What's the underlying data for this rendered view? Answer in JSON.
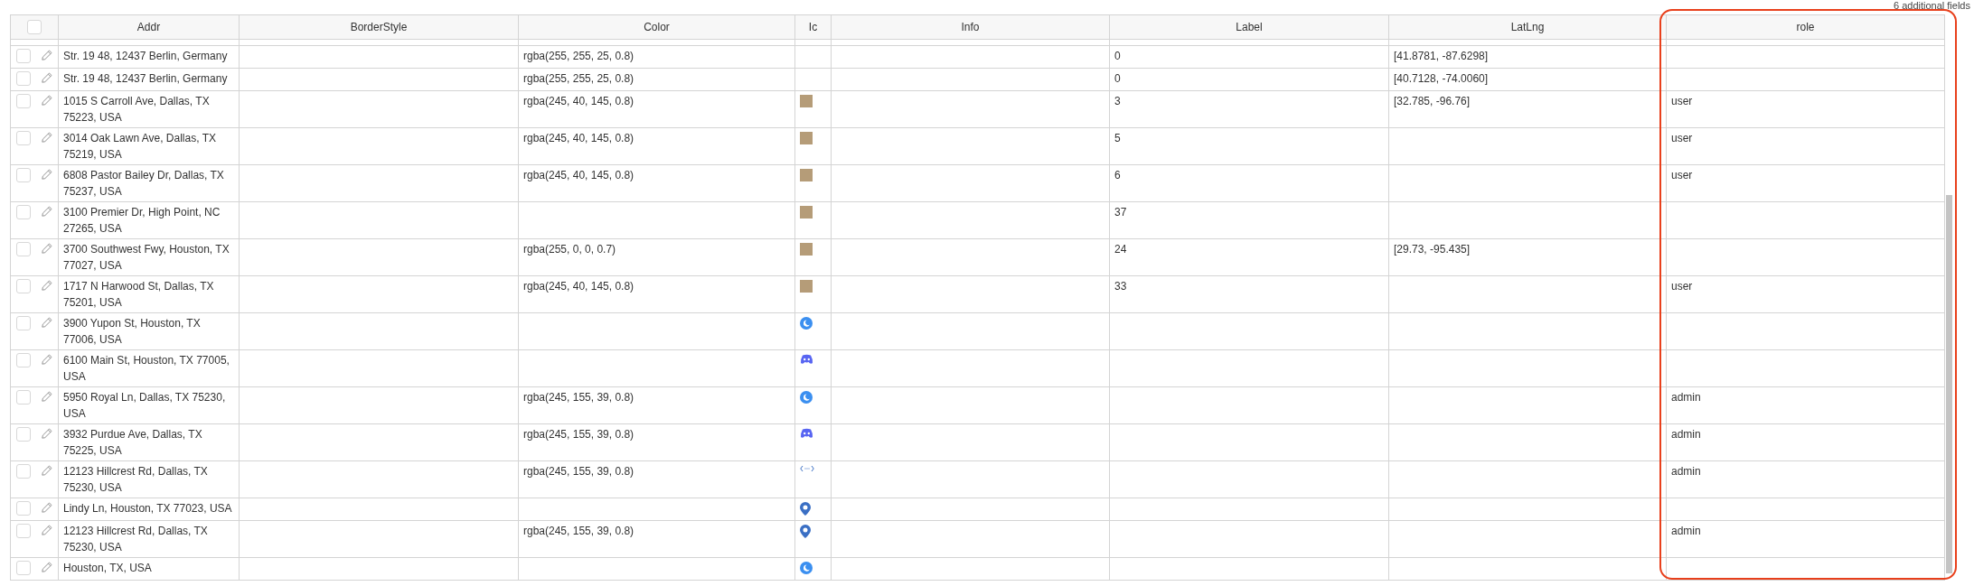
{
  "note": "6 additional fields",
  "table": {
    "select_all": {
      "checked": false
    },
    "columns": [
      {
        "label": "Addr",
        "highlighted": false
      },
      {
        "label": "BorderStyle",
        "highlighted": false
      },
      {
        "label": "Color",
        "highlighted": false
      },
      {
        "label": "Ic",
        "highlighted": false
      },
      {
        "label": "Info",
        "highlighted": false
      },
      {
        "label": "Label",
        "highlighted": false
      },
      {
        "label": "LatLng",
        "highlighted": false
      },
      {
        "label": "role",
        "highlighted": true
      }
    ],
    "rows": [
      {
        "selected": false,
        "addr": "Str. 19 48, 12437 Berlin, Germany",
        "color_text": "rgba(255, 255, 25, 0.8)",
        "label": "0",
        "latlng": "[41.8781, -87.6298]"
      },
      {
        "selected": false,
        "addr": "Str. 19 48, 12437 Berlin, Germany",
        "color_text": "rgba(255, 255, 25, 0.8)",
        "label": "0",
        "latlng": "[40.7128, -74.0060]"
      },
      {
        "selected": false,
        "addr": "1015 S Carroll Ave, Dallas, TX 75223, USA",
        "color_text": "rgba(245, 40, 145, 0.8)",
        "ic": {
          "kind": "photo"
        },
        "label": "3",
        "latlng": "[32.785, -96.76]",
        "role": "user"
      },
      {
        "selected": false,
        "addr": "3014 Oak Lawn Ave, Dallas, TX 75219, USA",
        "color_text": "rgba(245, 40, 145, 0.8)",
        "ic": {
          "kind": "photo"
        },
        "label": "5",
        "role": "user"
      },
      {
        "selected": false,
        "addr": "6808 Pastor Bailey Dr, Dallas, TX 75237, USA",
        "color_text": "rgba(245, 40, 145, 0.8)",
        "ic": {
          "kind": "photo"
        },
        "label": "6",
        "role": "user"
      },
      {
        "selected": false,
        "addr": "3100 Premier Dr, High Point, NC 27265, USA",
        "ic": {
          "kind": "photo"
        },
        "label": "37"
      },
      {
        "selected": false,
        "addr": "3700 Southwest Fwy, Houston, TX 77027, USA",
        "color_text": "rgba(255, 0, 0, 0.7)",
        "ic": {
          "kind": "photo"
        },
        "label": "24",
        "latlng": "[29.73, -95.435]"
      },
      {
        "selected": false,
        "addr": "1717 N Harwood St, Dallas, TX 75201, USA",
        "color_text": "rgba(245, 40, 145, 0.8)",
        "ic": {
          "kind": "photo"
        },
        "label": "33",
        "role": "user"
      },
      {
        "selected": false,
        "addr": "3900 Yupon St, Houston, TX 77006, USA",
        "ic": {
          "kind": "moon"
        }
      },
      {
        "selected": false,
        "addr": "6100 Main St, Houston, TX 77005, USA",
        "ic": {
          "kind": "gamepad"
        }
      },
      {
        "selected": false,
        "addr": "5950 Royal Ln, Dallas, TX 75230, USA",
        "color_text": "rgba(245, 155, 39, 0.8)",
        "ic": {
          "kind": "moon"
        },
        "role": "admin"
      },
      {
        "selected": false,
        "addr": "3932 Purdue Ave, Dallas, TX 75225, USA",
        "color_text": "rgba(245, 155, 39, 0.8)",
        "ic": {
          "kind": "gamepad"
        },
        "role": "admin"
      },
      {
        "selected": false,
        "addr": "12123 Hillcrest Rd, Dallas, TX 75230, USA",
        "color_text": "rgba(245, 155, 39, 0.8)",
        "ic": {
          "kind": "code"
        },
        "role": "admin"
      },
      {
        "selected": false,
        "addr": "Lindy Ln, Houston, TX 77023, USA",
        "ic": {
          "kind": "pin"
        }
      },
      {
        "selected": false,
        "addr": "12123 Hillcrest Rd, Dallas, TX 75230, USA",
        "color_text": "rgba(245, 155, 39, 0.8)",
        "ic": {
          "kind": "pin"
        },
        "role": "admin"
      },
      {
        "selected": false,
        "addr": "Houston, TX, USA",
        "ic": {
          "kind": "moon"
        }
      }
    ]
  }
}
